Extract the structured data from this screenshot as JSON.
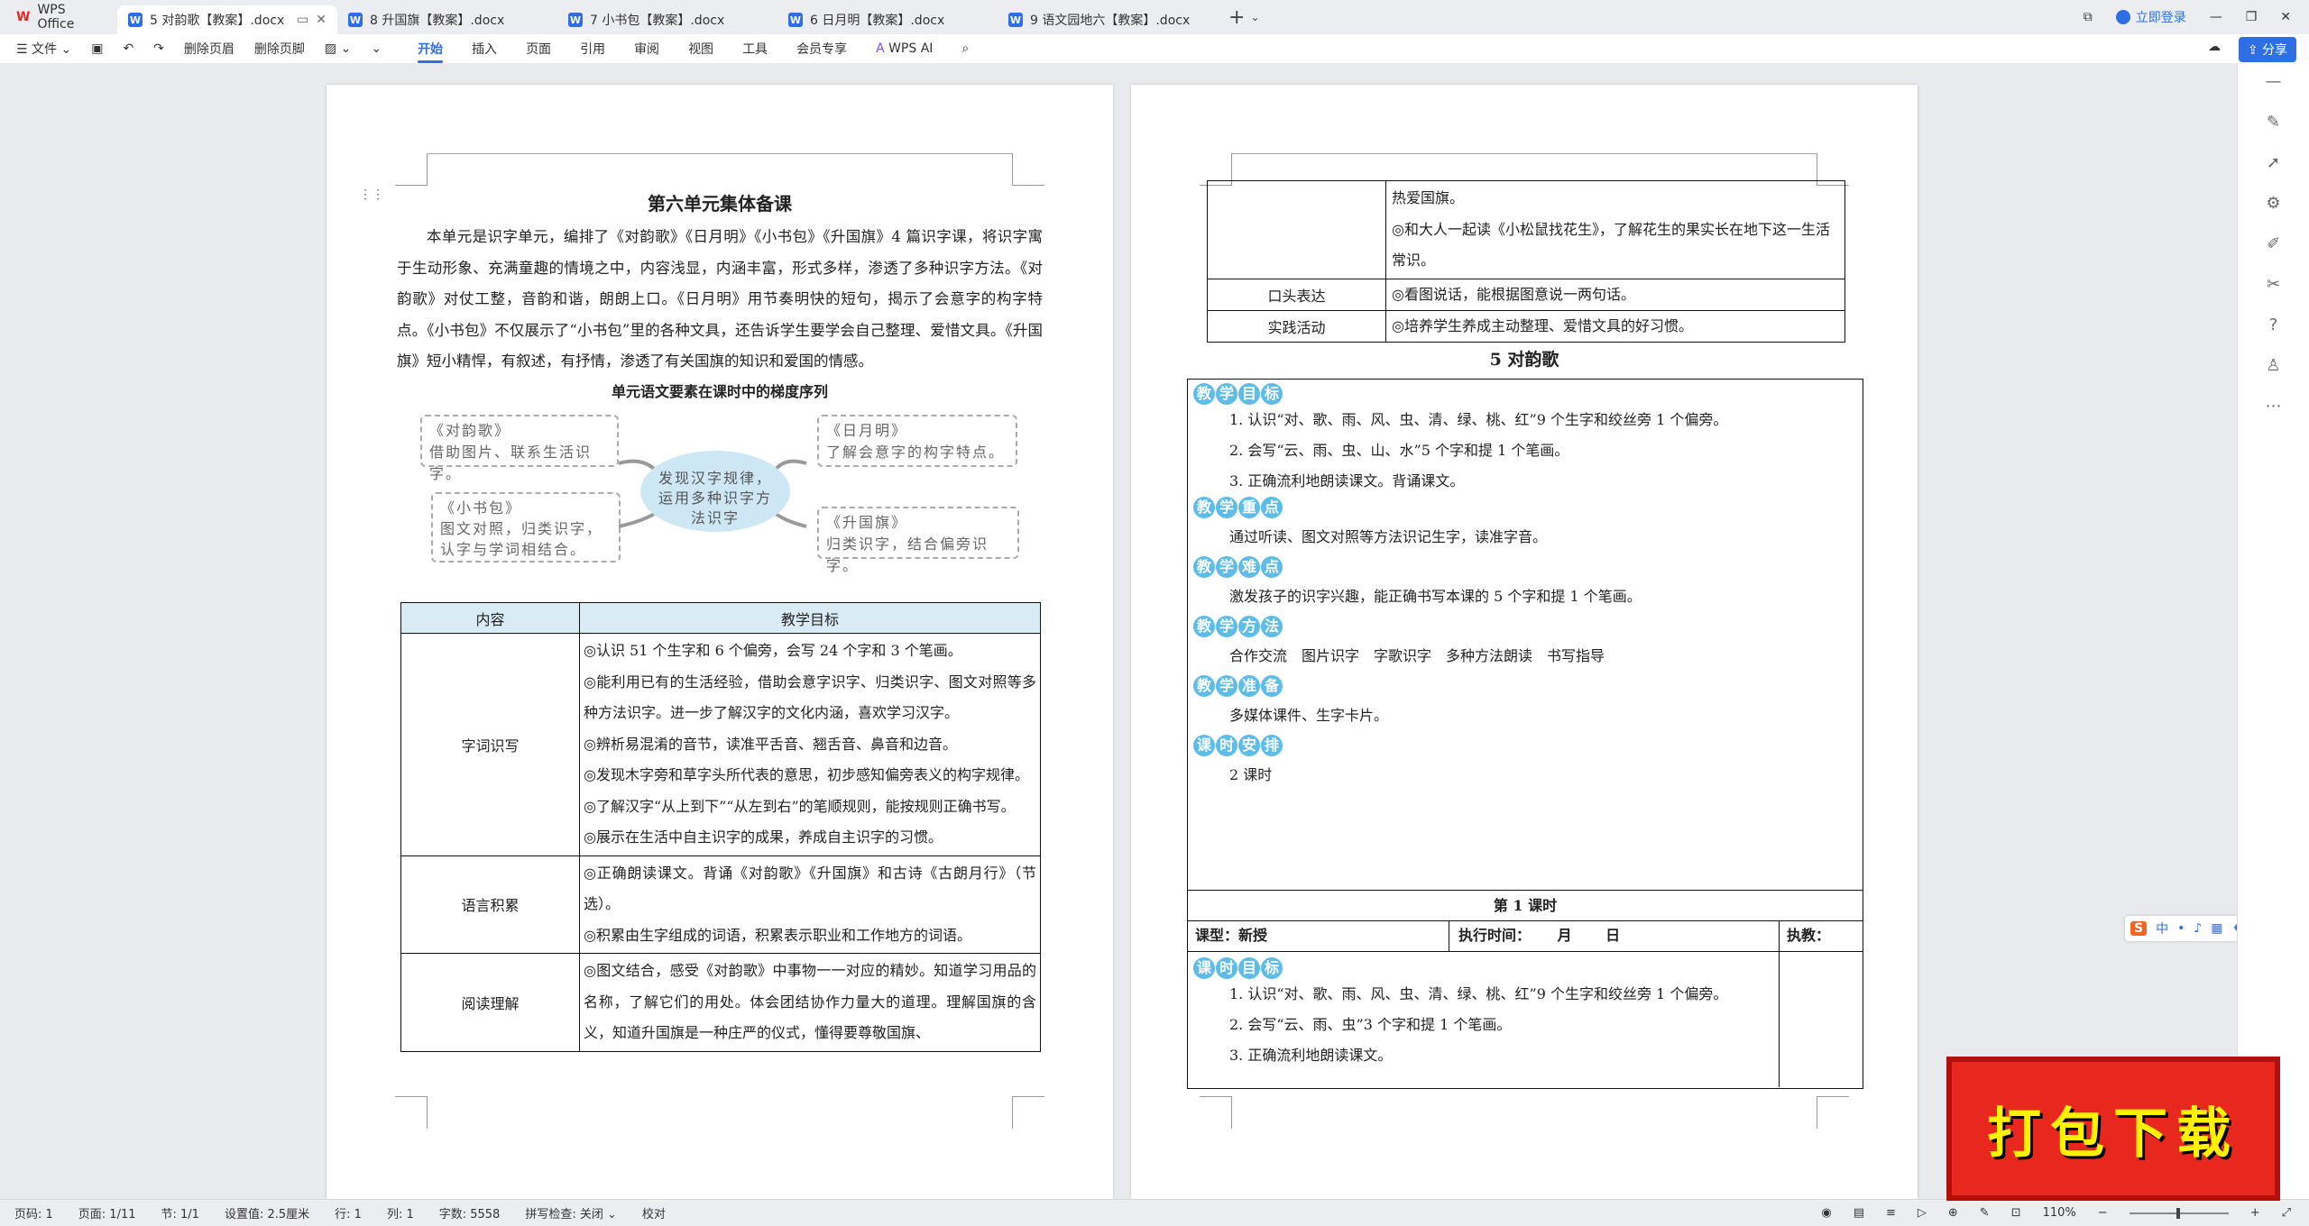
{
  "app": {
    "title": "WPS Office",
    "login": "立即登录",
    "share": "分享"
  },
  "tabs": [
    {
      "label": "5 对韵歌【教案】.docx"
    },
    {
      "label": "8 升国旗【教案】.docx"
    },
    {
      "label": "7 小书包【教案】.docx"
    },
    {
      "label": "6 日月明【教案】.docx"
    },
    {
      "label": "9 语文园地六【教案】.docx"
    }
  ],
  "toolbar": {
    "file": "文件",
    "del_header": "删除页眉",
    "del_footer": "删除页脚",
    "menus": [
      "开始",
      "插入",
      "页面",
      "引用",
      "审阅",
      "视图",
      "工具",
      "会员专享"
    ],
    "wps_ai": "WPS AI"
  },
  "page1": {
    "title": "第六单元集体备课",
    "intro": "本单元是识字单元，编排了《对韵歌》《日月明》《小书包》《升国旗》4 篇识字课，将识字寓于生动形象、充满童趣的情境之中，内容浅显，内涵丰富，形式多样，渗透了多种识字方法。《对韵歌》对仗工整，音韵和谐，朗朗上口。《日月明》用节奏明快的短句，揭示了会意字的构字特点。《小书包》不仅展示了“小书包”里的各种文具，还告诉学生要学会自己整理、爱惜文具。《升国旗》短小精悍，有叙述，有抒情，渗透了有关国旗的知识和爱国的情感。",
    "subtitle": "单元语文要素在课时中的梯度序列",
    "mind": {
      "center": "发现汉字规律，运用多种识字方法识字",
      "tl_title": "《对韵歌》",
      "tl_body": "借助图片、联系生活识字。",
      "tr_title": "《日月明》",
      "tr_body": "了解会意字的构字特点。",
      "bl_title": "《小书包》",
      "bl_body": "图文对照，归类识字，认字与学词相结合。",
      "br_title": "《升国旗》",
      "br_body": "归类识字，结合偏旁识字。"
    },
    "table": {
      "head": [
        "内容",
        "教学目标"
      ],
      "rows": [
        {
          "label": "字词识写",
          "items": [
            "◎认识 51 个生字和 6 个偏旁，会写 24 个字和 3 个笔画。",
            "◎能利用已有的生活经验，借助会意字识字、归类识字、图文对照等多种方法识字。进一步了解汉字的文化内涵，喜欢学习汉字。",
            "◎辨析易混淆的音节，读准平舌音、翘舌音、鼻音和边音。",
            "◎发现木字旁和草字头所代表的意思，初步感知偏旁表义的构字规律。",
            "◎了解汉字“从上到下”“从左到右”的笔顺规则，能按规则正确书写。",
            "◎展示在生活中自主识字的成果，养成自主识字的习惯。"
          ]
        },
        {
          "label": "语言积累",
          "items": [
            "◎正确朗读课文。背诵《对韵歌》《升国旗》和古诗《古朗月行》（节选）。",
            "◎积累由生字组成的词语，积累表示职业和工作地方的词语。"
          ]
        },
        {
          "label": "阅读理解",
          "items": [
            "◎图文结合，感受《对韵歌》中事物一一对应的精妙。知道学习用品的名称，了解它们的用处。体会团结协作力量大的道理。理解国旗的含义，知道升国旗是一种庄严的仪式，懂得要尊敬国旗、"
          ]
        }
      ]
    }
  },
  "page2": {
    "cont_rows": [
      {
        "label": "",
        "items": [
          "热爱国旗。",
          "◎和大人一起读《小松鼠找花生》，了解花生的果实长在地下这一生活常识。"
        ]
      },
      {
        "label": "口头表达",
        "items": [
          "◎看图说话，能根据图意说一两句话。"
        ]
      },
      {
        "label": "实践活动",
        "items": [
          "◎培养学生养成主动整理、爱惜文具的好习惯。"
        ]
      }
    ],
    "lesson_title": "5 对韵歌",
    "sections": [
      {
        "badge": "教学目标",
        "lines": [
          "1. 认识“对、歌、雨、风、虫、清、绿、桃、红”9 个生字和绞丝旁 1 个偏旁。",
          "2. 会写“云、雨、虫、山、水”5 个字和提 1 个笔画。",
          "3. 正确流利地朗读课文。背诵课文。"
        ]
      },
      {
        "badge": "教学重点",
        "lines": [
          "通过听读、图文对照等方法识记生字，读准字音。"
        ]
      },
      {
        "badge": "教学难点",
        "lines": [
          "激发孩子的识字兴趣，能正确书写本课的 5 个字和提 1 个笔画。"
        ]
      },
      {
        "badge": "教学方法",
        "lines": [
          "合作交流　图片识字　字歌识字　多种方法朗读　书写指导"
        ]
      },
      {
        "badge": "教学准备",
        "lines": [
          "多媒体课件、生字卡片。"
        ]
      },
      {
        "badge": "课时安排",
        "lines": [
          "2 课时"
        ]
      }
    ],
    "period": {
      "title": "第 1 课时",
      "type": "课型：新授",
      "time": "执行时间：　　 月　　 日",
      "teacher": "执教："
    },
    "goal_badge": "课时目标",
    "goal_lines": [
      "1. 认识“对、歌、雨、风、虫、清、绿、桃、红”9 个生字和绞丝旁 1 个偏旁。",
      "2. 会写“云、雨、虫”3 个字和提 1 个笔画。",
      "3. 正确流利地朗读课文。"
    ]
  },
  "status": {
    "page_num": "页码: 1",
    "pages": "页面: 1/11",
    "section": "节: 1/1",
    "setting": "设置值: 2.5厘米",
    "row": "行: 1",
    "col": "列: 1",
    "words": "字数: 5558",
    "spell": "拼写检查: 关闭",
    "proof": "校对",
    "zoom": "110%"
  },
  "download": "打包下载"
}
